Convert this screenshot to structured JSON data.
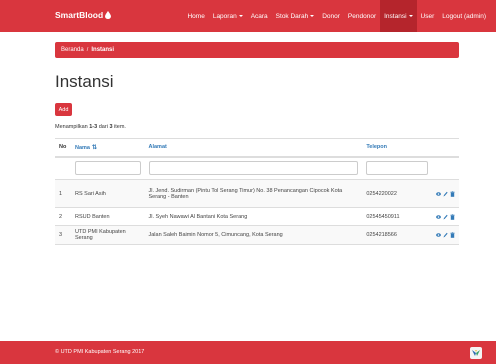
{
  "navbar": {
    "brand": "SmartBlood",
    "menu": [
      {
        "label": "Home",
        "caret": false,
        "active": false
      },
      {
        "label": "Laporan",
        "caret": true,
        "active": false
      },
      {
        "label": "Acara",
        "caret": false,
        "active": false
      },
      {
        "label": "Stok Darah",
        "caret": true,
        "active": false
      },
      {
        "label": "Donor",
        "caret": false,
        "active": false
      },
      {
        "label": "Pendonor",
        "caret": false,
        "active": false
      },
      {
        "label": "Instansi",
        "caret": true,
        "active": true
      },
      {
        "label": "User",
        "caret": false,
        "active": false
      },
      {
        "label": "Logout (admin)",
        "caret": false,
        "active": false
      }
    ]
  },
  "breadcrumb": {
    "home": "Beranda",
    "separator": "/",
    "current": "Instansi"
  },
  "page": {
    "title": "Instansi",
    "add_label": "Add",
    "summary": {
      "prefix": "Menampilkan",
      "range": "1-3",
      "middle": "dari",
      "total": "3",
      "suffix": "item."
    }
  },
  "table": {
    "headers": {
      "no": "No",
      "nama": "Nama",
      "alamat": "Alamat",
      "telepon": "Telepon"
    },
    "rows": [
      {
        "no": "1",
        "nama": "RS Sari Asih",
        "alamat": "Jl. Jend. Sudirman (Pintu Tol Serang Timur) No. 38 Penancangan Cipocok Kota Serang - Banten",
        "telepon": "0254220022"
      },
      {
        "no": "2",
        "nama": "RSUD Banten",
        "alamat": "Jl. Syeh Nawawi Al Bantani Kota Serang",
        "telepon": "02545450911"
      },
      {
        "no": "3",
        "nama": "UTD PMI Kabupaten Serang",
        "alamat": "Jalan Saleh Baimin Nomor 5, Cimuncang, Kota Serang",
        "telepon": "0254218566"
      }
    ]
  },
  "footer": {
    "text": "© UTD PMI Kabupaten Serang 2017"
  },
  "colors": {
    "brand": "#d9363e",
    "link": "#337ab7"
  },
  "icons": {
    "brand": "blood-drop-icon",
    "sort": "sort-icon",
    "view": "eye-icon",
    "edit": "pencil-icon",
    "delete": "trash-icon"
  }
}
